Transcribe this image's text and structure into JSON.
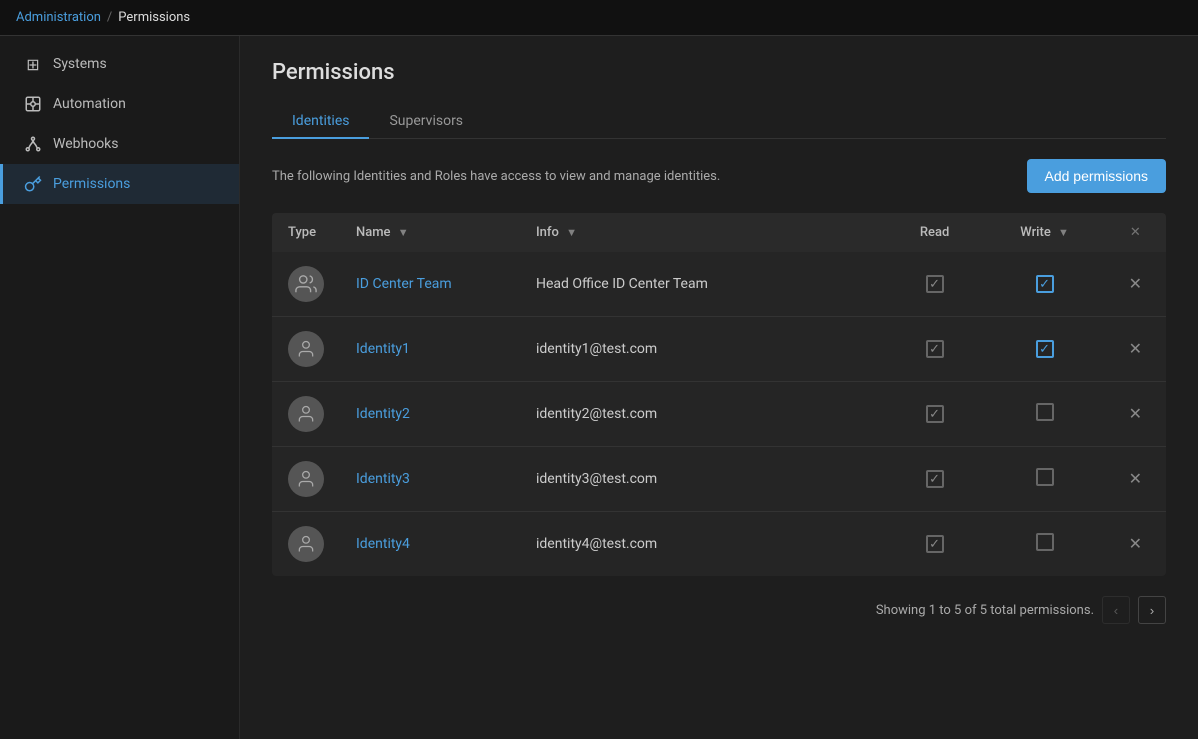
{
  "breadcrumb": {
    "parent": "Administration",
    "current": "Permissions"
  },
  "sidebar": {
    "items": [
      {
        "id": "systems",
        "label": "Systems",
        "icon": "⊞"
      },
      {
        "id": "automation",
        "label": "Automation",
        "icon": "🤖"
      },
      {
        "id": "webhooks",
        "label": "Webhooks",
        "icon": "⚙"
      },
      {
        "id": "permissions",
        "label": "Permissions",
        "icon": "🔑",
        "active": true
      }
    ]
  },
  "page": {
    "title": "Permissions"
  },
  "tabs": [
    {
      "id": "identities",
      "label": "Identities",
      "active": true
    },
    {
      "id": "supervisors",
      "label": "Supervisors",
      "active": false
    }
  ],
  "description": "The following Identities and Roles have access to view and manage identities.",
  "add_button": "Add permissions",
  "table": {
    "headers": {
      "type": "Type",
      "name": "Name",
      "info": "Info",
      "read": "Read",
      "write": "Write",
      "action": ""
    },
    "rows": [
      {
        "id": 1,
        "type": "group",
        "name": "ID Center Team",
        "info": "Head Office ID Center Team",
        "read": true,
        "write": true
      },
      {
        "id": 2,
        "type": "user",
        "name": "Identity1",
        "info": "identity1@test.com",
        "read": true,
        "write": true
      },
      {
        "id": 3,
        "type": "user",
        "name": "Identity2",
        "info": "identity2@test.com",
        "read": true,
        "write": false
      },
      {
        "id": 4,
        "type": "user",
        "name": "Identity3",
        "info": "identity3@test.com",
        "read": true,
        "write": false
      },
      {
        "id": 5,
        "type": "user",
        "name": "Identity4",
        "info": "identity4@test.com",
        "read": true,
        "write": false
      }
    ]
  },
  "pagination": {
    "text": "Showing 1 to 5 of 5 total permissions."
  },
  "colors": {
    "accent": "#4a9ede",
    "bg_dark": "#1e1e1e",
    "bg_sidebar": "#1a1a1a",
    "bg_table": "#252525"
  }
}
